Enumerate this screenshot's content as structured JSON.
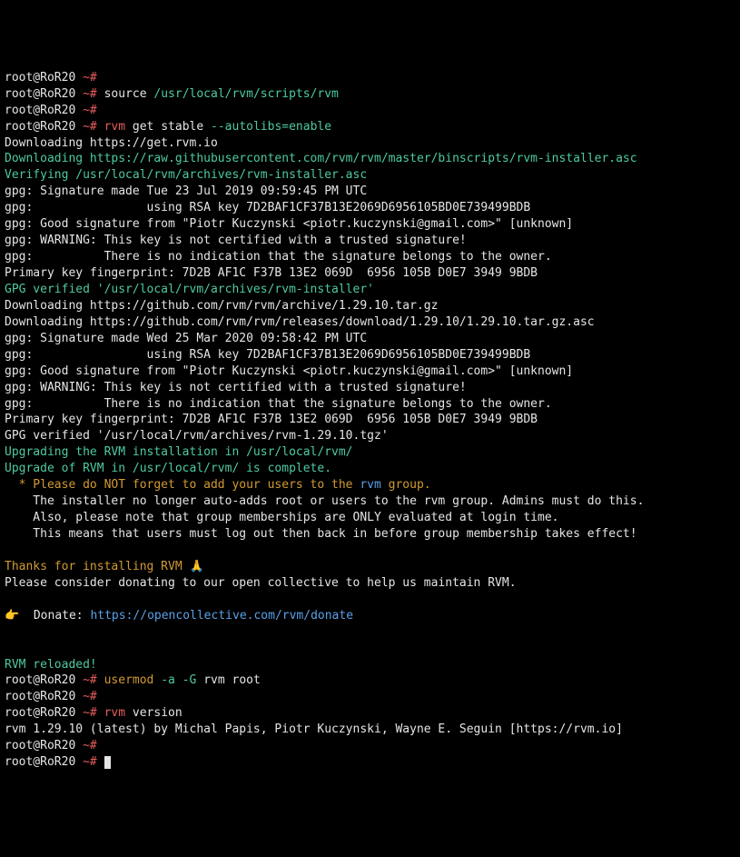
{
  "prompt": {
    "user_host": "root@RoR20",
    "tilde": "~#"
  },
  "cmd": {
    "source": "source",
    "source_path": "/usr/local/rvm/scripts/rvm",
    "rvm": "rvm",
    "get_stable": "get stable",
    "autolibs": "--autolibs=enable",
    "usermod": "usermod",
    "usermod_flags": "-a -G",
    "usermod_args": "rvm root",
    "version": "version"
  },
  "out": {
    "dl1": "Downloading https://get.rvm.io",
    "dl2": "Downloading https://raw.githubusercontent.com/rvm/rvm/master/binscripts/rvm-installer.asc",
    "verify1": "Verifying /usr/local/rvm/archives/rvm-installer.asc",
    "g1": "gpg: Signature made Tue 23 Jul 2019 09:59:45 PM UTC",
    "g2": "gpg:                using RSA key 7D2BAF1CF37B13E2069D6956105BD0E739499BDB",
    "g3": "gpg: Good signature from \"Piotr Kuczynski <piotr.kuczynski@gmail.com>\" [unknown]",
    "g4": "gpg: WARNING: This key is not certified with a trusted signature!",
    "g5": "gpg:          There is no indication that the signature belongs to the owner.",
    "g6": "Primary key fingerprint: 7D2B AF1C F37B 13E2 069D  6956 105B D0E7 3949 9BDB",
    "gpgv1": "GPG verified '/usr/local/rvm/archives/rvm-installer'",
    "dl3": "Downloading https://github.com/rvm/rvm/archive/1.29.10.tar.gz",
    "dl4": "Downloading https://github.com/rvm/rvm/releases/download/1.29.10/1.29.10.tar.gz.asc",
    "g7": "gpg: Signature made Wed 25 Mar 2020 09:58:42 PM UTC",
    "g8": "gpg:                using RSA key 7D2BAF1CF37B13E2069D6956105BD0E739499BDB",
    "g9": "gpg: Good signature from \"Piotr Kuczynski <piotr.kuczynski@gmail.com>\" [unknown]",
    "g10": "gpg: WARNING: This key is not certified with a trusted signature!",
    "g11": "gpg:          There is no indication that the signature belongs to the owner.",
    "g12": "Primary key fingerprint: 7D2B AF1C F37B 13E2 069D  6956 105B D0E7 3949 9BDB",
    "gpgv2": "GPG verified '/usr/local/rvm/archives/rvm-1.29.10.tgz'",
    "upg1": "Upgrading the RVM installation in /usr/local/rvm/",
    "upg2": "Upgrade of RVM in /usr/local/rvm/ is complete.",
    "note_prefix": "  * Please do NOT forget to add your users to the ",
    "note_rvm": "rvm",
    "note_suffix": " group.",
    "n1": "    The installer no longer auto-adds root or users to the rvm group. Admins must do this.",
    "n2": "    Also, please note that group memberships are ONLY evaluated at login time.",
    "n3": "    This means that users must log out then back in before group membership takes effect!",
    "thanks": "Thanks for installing RVM 🙏",
    "donate1": "Please consider donating to our open collective to help us maintain RVM.",
    "donate_prefix": "👉  Donate: ",
    "donate_url": "https://opencollective.com/rvm/donate",
    "reloaded": "RVM reloaded!",
    "version_out": "rvm 1.29.10 (latest) by Michal Papis, Piotr Kuczynski, Wayne E. Seguin [https://rvm.io]"
  }
}
